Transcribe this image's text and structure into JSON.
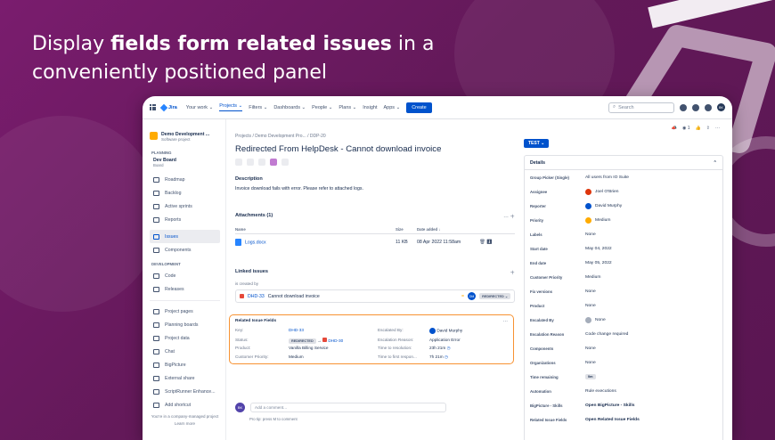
{
  "headline": {
    "before": "Display ",
    "bold": "fields form related issues",
    "after": " in a conveniently positioned panel"
  },
  "nav": {
    "logo": "Jira",
    "items": [
      "Your work ⌄",
      "Projects ⌄",
      "Filters ⌄",
      "Dashboards ⌄",
      "People ⌄",
      "Plans ⌄",
      "Insight",
      "Apps ⌄"
    ],
    "create": "Create",
    "search_placeholder": "Search",
    "avatar": "BK"
  },
  "sidebar": {
    "project_name": "Demo Development ...",
    "project_type": "Software project",
    "planning": "PLANNING",
    "board_name": "Dev Board",
    "board_sub": "Board",
    "planning_items": [
      "Roadmap",
      "Backlog",
      "Active sprints",
      "Reports"
    ],
    "issues": "Issues",
    "components": "Components",
    "development": "DEVELOPMENT",
    "dev_items": [
      "Code",
      "Releases"
    ],
    "other_items": [
      "Project pages",
      "Planning boards",
      "Project data",
      "Chat",
      "BigPicture",
      "External share",
      "ScriptRunner Enhance...",
      "Add shortcut"
    ],
    "foot1": "You're in a company-managed project",
    "foot2": "Learn more"
  },
  "issue": {
    "breadcrumb": "Projects  /  Demo Development Pro...  /  DDP-20",
    "title": "Redirected From HelpDesk - Cannot download invoice",
    "description_heading": "Description",
    "description": "Invoice download fails with error. Please refer to attached logs.",
    "attachments_heading": "Attachments (1)",
    "att_cols": [
      "Name",
      "Size",
      "Date added ↓"
    ],
    "att_row": {
      "name": "Logs.docx",
      "size": "11 KB",
      "date": "08 Apr 2022 11:58am"
    },
    "linked_heading": "Linked issues",
    "is_created_by": "is created by",
    "linked_key": "DHD-33",
    "linked_summary": "Cannot download invoice",
    "linked_status": "REDIRECTED ⌄",
    "linked_avatar": "DM",
    "rif_title": "Related Issue Fields",
    "rif": {
      "key_label": "Key:",
      "key_value": "DHD-33",
      "status_label": "Status:",
      "status_value": "REDIRECTED",
      "status_arrow": "→",
      "status_target": "DHD-30",
      "product_label": "Product:",
      "product_value": "Vanilla Billing Service",
      "cp_label": "Customer Priority:",
      "cp_value": "Medium",
      "esc_by_label": "Escalated By:",
      "esc_by_value": "David Murphy",
      "esc_reason_label": "Escalation Reason:",
      "esc_reason_value": "Application Error",
      "ttr_label": "Time to resolution:",
      "ttr_value": "23h 21m",
      "ttfr_label": "Time to first respon...",
      "ttfr_value": "7h 21m"
    },
    "comment_avatar": "BK",
    "comment_placeholder": "Add a comment...",
    "protip": "Pro tip: press  M  to comment"
  },
  "right": {
    "watch_count": "1",
    "status_button": "TEST ⌄",
    "details_heading": "Details",
    "rows": [
      {
        "label": "Group Picker (Single)",
        "value": "All users from IO Suite"
      },
      {
        "label": "Assignee",
        "value": "Joel O'Brien",
        "avatar": "#de350b"
      },
      {
        "label": "Reporter",
        "value": "David Murphy",
        "avatar": "#0052cc"
      },
      {
        "label": "Priority",
        "value": "Medium",
        "avatar": "#ffab00"
      },
      {
        "label": "Labels",
        "value": "None"
      },
      {
        "label": "Start date",
        "value": "May 04, 2022"
      },
      {
        "label": "End date",
        "value": "May 05, 2022"
      },
      {
        "label": "Customer Priority",
        "value": "Medium"
      },
      {
        "label": "Fix versions",
        "value": "None"
      },
      {
        "label": "Product",
        "value": "None"
      },
      {
        "label": "Escalated By",
        "value": "None",
        "avatar": "#a5adba"
      },
      {
        "label": "Escalation Reason",
        "value": "Code change required"
      },
      {
        "label": "Components",
        "value": "None"
      },
      {
        "label": "Organizations",
        "value": "None"
      },
      {
        "label": "Time remaining",
        "value": "0m",
        "pill": true
      },
      {
        "label": "Automation",
        "value": "Rule executions"
      },
      {
        "label": "BigPicture - Skills",
        "value": "Open BigPicture - Skills",
        "bold": true
      },
      {
        "label": "Related Issue Fields",
        "value": "Open Related Issue Fields",
        "bold": true
      }
    ]
  }
}
